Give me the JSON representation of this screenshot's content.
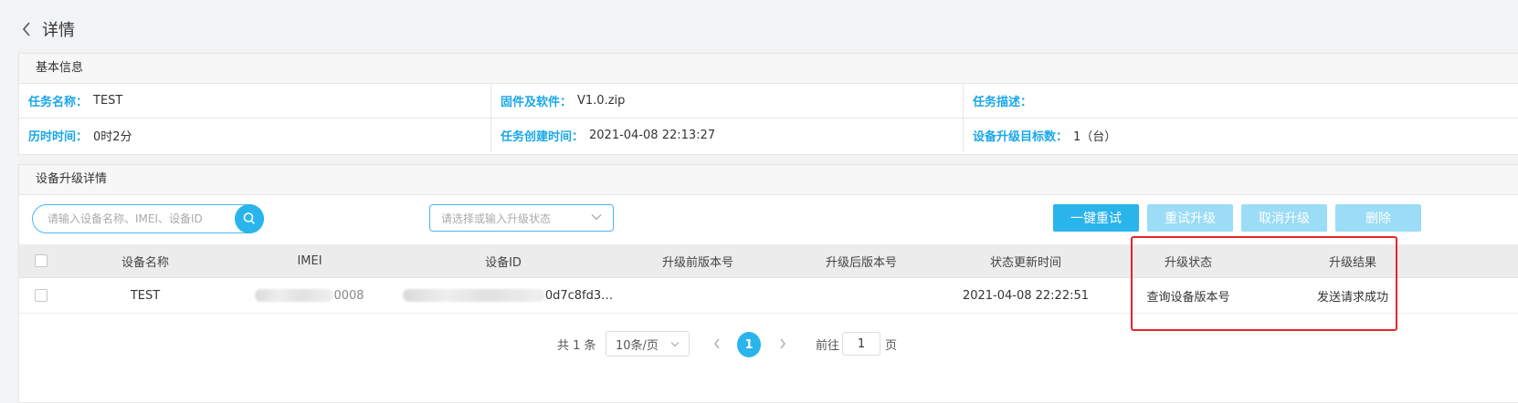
{
  "header": {
    "title": "详情"
  },
  "basic_info": {
    "title": "基本信息",
    "fields": [
      {
        "label": "任务名称：",
        "value": "TEST"
      },
      {
        "label": "固件及软件：",
        "value": "V1.0.zip"
      },
      {
        "label": "任务描述：",
        "value": ""
      },
      {
        "label": "历时时间：",
        "value": "0时2分"
      },
      {
        "label": "任务创建时间：",
        "value": "2021-04-08 22:13:27"
      },
      {
        "label": "设备升级目标数：",
        "value": "1（台）"
      }
    ]
  },
  "detail": {
    "title": "设备升级详情",
    "search_placeholder": "请输入设备名称、IMEI、设备ID",
    "status_placeholder": "请选择或输入升级状态",
    "buttons": {
      "retry_all": "一键重试",
      "retry_upgrade": "重试升级",
      "cancel_upgrade": "取消升级",
      "delete": "删除"
    },
    "columns": [
      "设备名称",
      "IMEI",
      "设备ID",
      "升级前版本号",
      "升级后版本号",
      "状态更新时间",
      "升级状态",
      "升级结果"
    ],
    "rows": [
      {
        "device_name": "TEST",
        "imei_visible": "0008",
        "device_id_visible": "0d7c8fd3…",
        "version_before": "",
        "version_after": "",
        "update_time": "2021-04-08 22:22:51",
        "upgrade_status": "查询设备版本号",
        "upgrade_result": "发送请求成功"
      }
    ]
  },
  "pagination": {
    "total": "共 1 条",
    "page_size": "10条/页",
    "current_page": "1",
    "goto_label": "前往",
    "goto_value": "1",
    "page_unit": "页"
  },
  "colors": {
    "accent": "#29b4ec",
    "accent_disabled": "#9bdcf7",
    "label": "#1aa7e8",
    "highlight": "#e8242b"
  }
}
